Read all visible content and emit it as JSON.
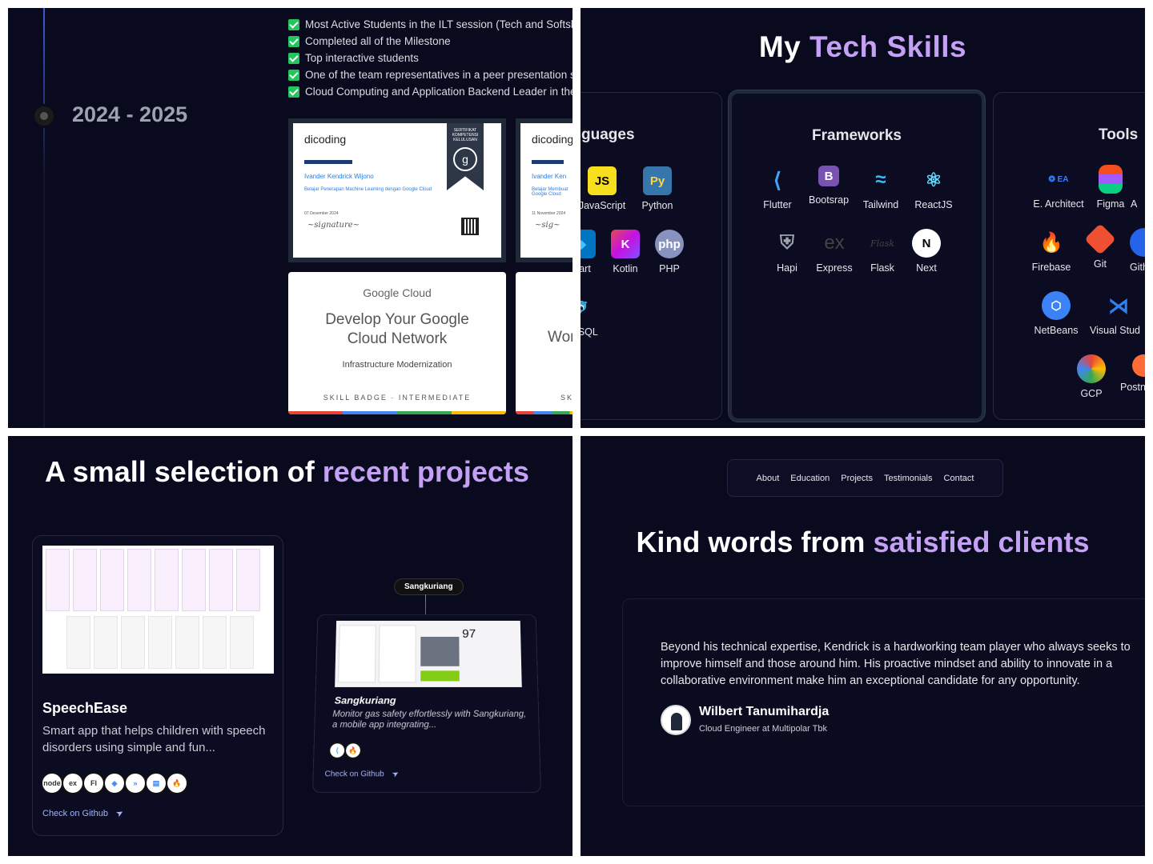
{
  "timeline": {
    "year": "2024 - 2025",
    "achievements": [
      "Most Active Students in the ILT session (Tech and Softski",
      "Completed all of the Milestone",
      "Top interactive students",
      "One of the team representatives in a peer presentation s",
      "Cloud Computing and Application Backend Leader in the"
    ],
    "cert1": {
      "logo": "dicoding",
      "ribbon": "SERTIFIKAT KOMPETENSI KELULUSAN",
      "name": "Ivander Kendrick Wijono",
      "course": "Belajar Penerapan Machine Learning dengan Google Cloud",
      "date": "07 Desember 2024"
    },
    "cert2": {
      "logo": "dicoding",
      "name": "Ivander Ken",
      "course": "Belajar Membuat Google Cloud",
      "date": "11 November 2024"
    },
    "badge1": {
      "brand": "Google Cloud",
      "title": "Develop Your Google Cloud Network",
      "subtitle": "Infrastructure Modernization",
      "kind": "SKILL BADGE · INTERMEDIATE"
    },
    "badge2": {
      "title": "Wor",
      "kind": "SK"
    }
  },
  "skills": {
    "title_plain": "My",
    "title_accent": "Tech Skills",
    "languages": {
      "title": "guages",
      "items": [
        "JavaScript",
        "Python",
        "Dart",
        "Kotlin",
        "PHP",
        "MySQL"
      ]
    },
    "frameworks": {
      "title": "Frameworks",
      "items": [
        "Flutter",
        "Bootsrap",
        "Tailwind",
        "ReactJS",
        "Hapi",
        "Express",
        "Flask",
        "Next"
      ]
    },
    "tools": {
      "title": "Tools",
      "items": [
        "E. Architect",
        "Figma",
        "A",
        "Firebase",
        "Git",
        "Gith",
        "NetBeans",
        "Visual Stud",
        "GCP",
        "Postn"
      ]
    }
  },
  "projects": {
    "title_plain": "A small selection of",
    "title_accent": "recent projects",
    "speechease": {
      "name": "SpeechEase",
      "desc": "Smart app that helps children with speech disorders using simple and fun...",
      "github": "Check on Github"
    },
    "sangkuriang": {
      "pill": "Sangkuriang",
      "name": "Sangkuriang",
      "desc": "Monitor gas safety effortlessly with Sangkuriang, a mobile app integrating...",
      "github": "Check on Github",
      "reading": "97"
    }
  },
  "testimonials": {
    "nav": [
      "About",
      "Education",
      "Projects",
      "Testimonials",
      "Contact"
    ],
    "title_plain": "Kind words from",
    "title_accent": "satisfied clients",
    "quote": "Beyond his technical expertise, Kendrick is a hardworking team player who always seeks to improve himself and those around him. His proactive mindset and ability to innovate in a collaborative environment make him an exceptional candidate for any opportunity.",
    "author": "Wilbert Tanumihardja",
    "role": "Cloud Engineer at Multipolar Tbk"
  },
  "colors": {
    "background": "#0a0a1f",
    "accent": "#c4a1f5",
    "check": "#22c55e"
  }
}
